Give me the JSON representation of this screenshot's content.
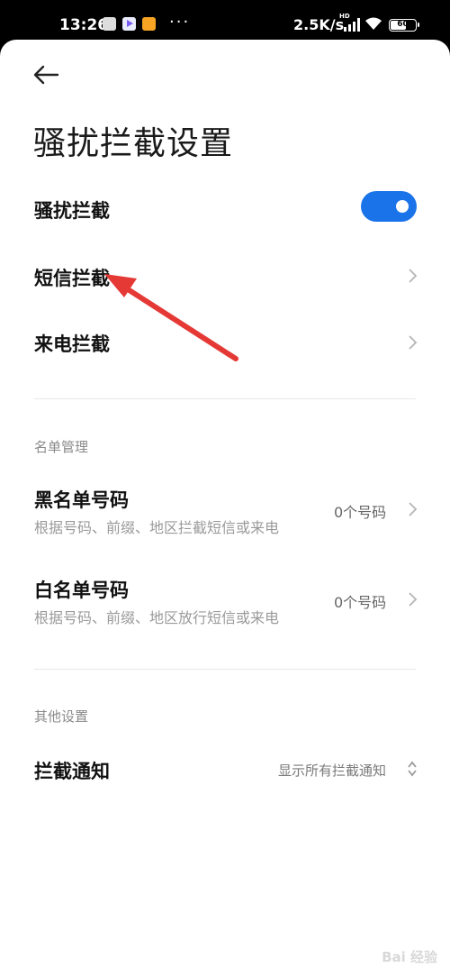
{
  "status_bar": {
    "time": "13:26",
    "dots": "···",
    "network_speed": "2.5K/s",
    "network_label": "HD",
    "battery": "60"
  },
  "header": {
    "back_icon": "arrow-left-icon",
    "title": "骚扰拦截设置"
  },
  "settings": {
    "harassment_block": {
      "label": "骚扰拦截",
      "enabled": true
    },
    "sms_block": {
      "label": "短信拦截"
    },
    "call_block": {
      "label": "来电拦截"
    }
  },
  "list_management": {
    "header": "名单管理",
    "blacklist": {
      "label": "黑名单号码",
      "subtitle": "根据号码、前缀、地区拦截短信或来电",
      "value": "0个号码"
    },
    "whitelist": {
      "label": "白名单号码",
      "subtitle": "根据号码、前缀、地区放行短信或来电",
      "value": "0个号码"
    }
  },
  "other_settings": {
    "header": "其他设置",
    "block_notification": {
      "label": "拦截通知",
      "value": "显示所有拦截通知"
    }
  },
  "colors": {
    "accent": "#1a73e8",
    "annotation_arrow": "#e53935"
  },
  "watermark": "Bai 经验"
}
